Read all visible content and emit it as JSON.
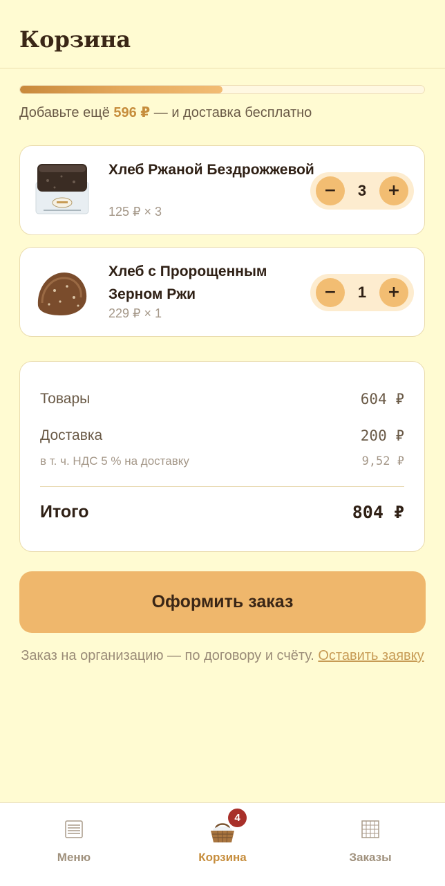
{
  "header": {
    "title": "Корзина"
  },
  "delivery_progress": {
    "fraction": 0.5,
    "hint_before": "Добавьте ещё ",
    "amount": "596 ₽",
    "hint_after": " — и доставка бесплатно"
  },
  "cart": {
    "items": [
      {
        "name": "Хлеб Ржаной Бездрожжевой",
        "price": "125 ₽ × 3",
        "qty": "3",
        "image": "rye-bread-loaf-photo"
      },
      {
        "name": "Хлеб с Пророщенным Зерном Ржи",
        "price": "229 ₽ × 1",
        "qty": "1",
        "image": "round-sprouted-rye-bread-photo"
      }
    ],
    "minus_label": "−",
    "plus_label": "+"
  },
  "summary": {
    "goods_label": "Товары",
    "goods_value": "604 ₽",
    "delivery_label": "Доставка",
    "delivery_value": "200 ₽",
    "vat_label": "в т. ч. НДС 5 % на доставку",
    "vat_value": "9,52 ₽",
    "total_label": "Итого",
    "total_value": "804 ₽"
  },
  "checkout": {
    "label": "Оформить заказ"
  },
  "org_note": {
    "text": "Заказ на организацию — по договору и счёту. ",
    "link": "Оставить заявку"
  },
  "tabs": {
    "menu": {
      "label": "Меню",
      "icon": "menu-list-icon"
    },
    "cart": {
      "label": "Корзина",
      "icon": "bread-basket-icon",
      "badge": "4"
    },
    "orders": {
      "label": "Заказы",
      "icon": "orders-grid-icon"
    }
  },
  "colors": {
    "background": "#fffbd2",
    "accent": "#efb76c",
    "accent_text": "#c68d3c",
    "badge": "#a8302a"
  }
}
